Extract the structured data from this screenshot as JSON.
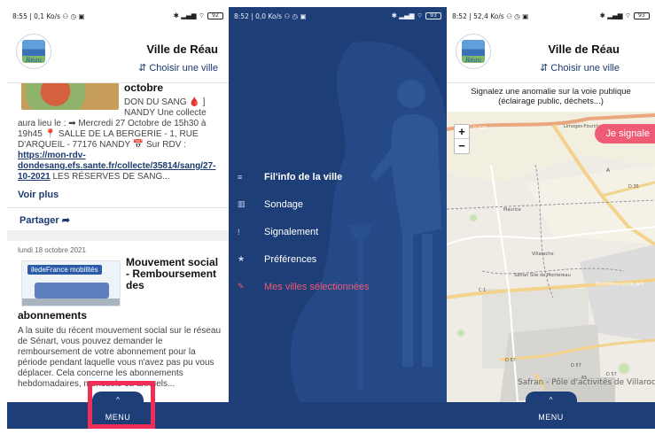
{
  "colors": {
    "primary": "#1e3e77",
    "accent": "#ef5b74",
    "highlight": "#ef2d56"
  },
  "screen1": {
    "status": {
      "time": "8:55",
      "speed": "0,1 Ko/s",
      "battery": "92"
    },
    "header": {
      "city": "Ville de Réau",
      "choose": "⇵ Choisir une ville",
      "logo_text": "Réau"
    },
    "post1": {
      "title": "octobre",
      "text_side": "DON DU SANG 🩸 ] NANDY Une collecte",
      "text_full_pre": "aura lieu le : ➡ Mercredi 27 Octobre de 15h30 à 19h45 📍 SALLE DE LA BERGERIE - 1, RUE D'ARQUEIL - 77176 NANDY 📅 Sur RDV : ",
      "link": "https://mon-rdv-dondesang.efs.sante.fr/collecte/35814/sang/27-10-2021",
      "text_full_post": " LES RÉSERVES DE SANG...",
      "more": "Voir plus",
      "share": "Partager ➦"
    },
    "post2": {
      "date": "lundi 18 octobre 2021",
      "thumb_logo": "iledeFrance mobilités",
      "title_side": "Mouvement social - Remboursement des",
      "title_rest": "abonnements",
      "text": "A la suite du récent mouvement social sur le réseau de Sénart, vous pouvez demander le remboursement de votre abonnement pour la période pendant laquelle vous n'avez pas pu vous déplacer. Cela concerne les abonnements hebdomadaires, mensuels ou annuels..."
    },
    "menu": {
      "caret": "^",
      "label": "MENU"
    }
  },
  "screen2": {
    "status": {
      "time": "8:52",
      "speed": "0,0 Ko/s",
      "battery": "93"
    },
    "items": [
      {
        "icon": "≡",
        "label": "Fil'info de la ville"
      },
      {
        "icon": "▥",
        "label": "Sondage"
      },
      {
        "icon": "!",
        "label": "Signalement"
      },
      {
        "icon": "★",
        "label": "Préférences"
      },
      {
        "icon": "✎",
        "label": "Mes villes sélectionnées"
      }
    ]
  },
  "screen3": {
    "status": {
      "time": "8:52",
      "speed": "52,4 Ko/s",
      "battery": "93"
    },
    "header": {
      "city": "Ville de Réau",
      "choose": "⇵ Choisir une ville",
      "logo_text": "Réau"
    },
    "report_title": "Signalez une anomalie sur la voie publique (éclairage public, déchets...)",
    "map": {
      "zoom_in": "+",
      "zoom_out": "−",
      "report_button": "Je signale",
      "labels": {
        "limoges": "Limoges-Fourches",
        "d619": "D 619",
        "a": "A",
        "d35": "D 35",
        "maurice": "Maurice",
        "villaroche": "Villaroche",
        "safran": "Safran Site de Montereau",
        "montereau": "Montereau-sur-le-Jard",
        "c1": "C 1",
        "d57": "D 57",
        "d57b": "D 57",
        "d57c": "D 57",
        "n6": "65",
        "safran_pole": "Safran - Pôle d'activités de Villaroche"
      }
    },
    "menu": {
      "caret": "^",
      "label": "MENU"
    }
  }
}
